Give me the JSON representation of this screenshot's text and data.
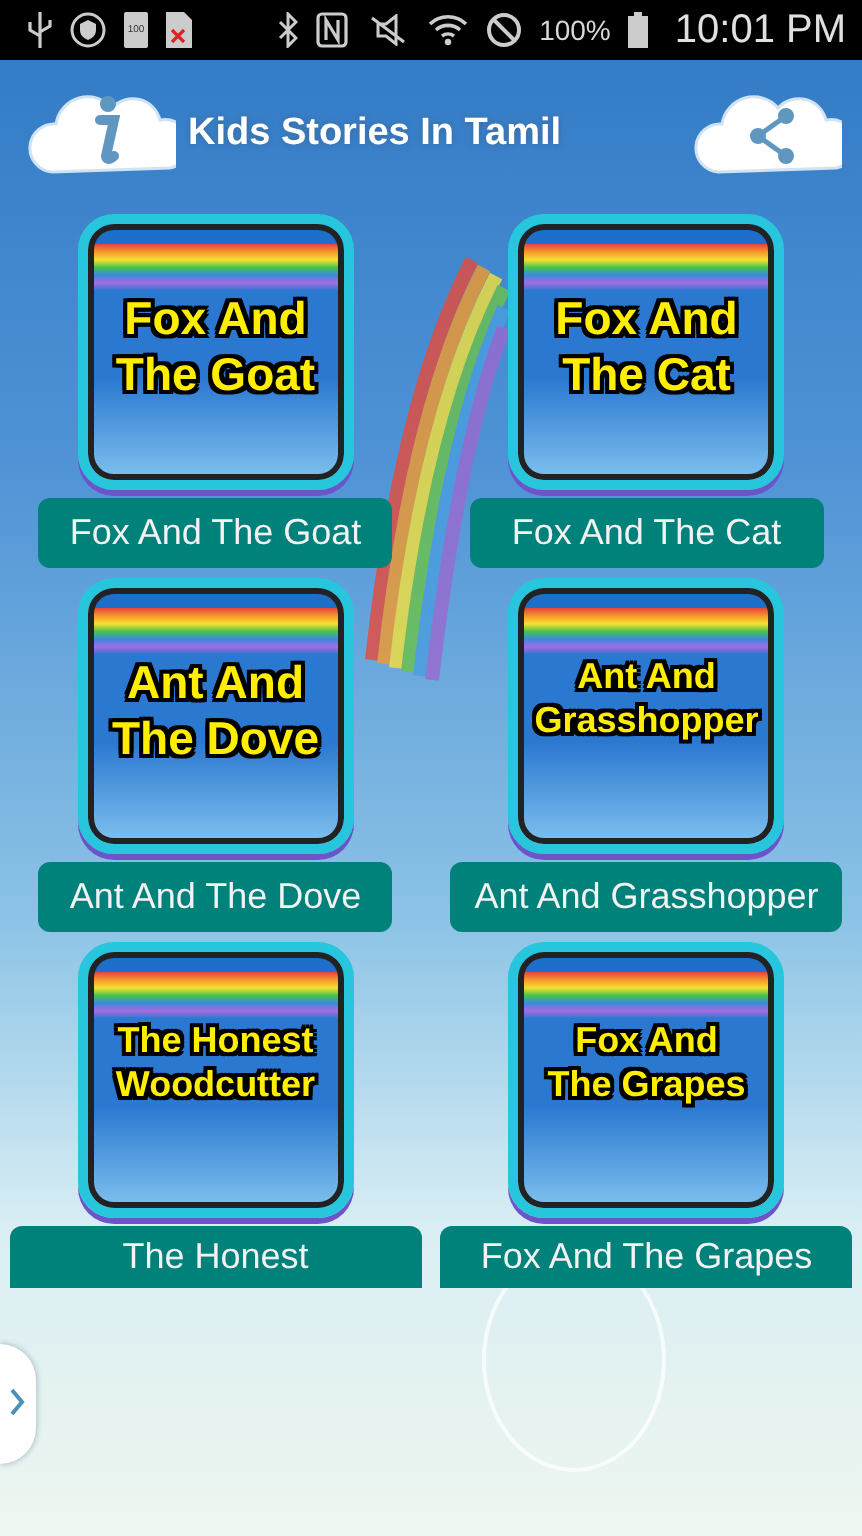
{
  "status_bar": {
    "battery_card": "100",
    "battery_percent": "100%",
    "time": "10:01 PM"
  },
  "header": {
    "title": "Kids Stories In Tamil"
  },
  "stories": [
    {
      "cover_lines": [
        "Fox And",
        "The Goat"
      ],
      "label": "Fox And The Goat"
    },
    {
      "cover_lines": [
        "Fox And",
        "The Cat"
      ],
      "label": "Fox And The Cat"
    },
    {
      "cover_lines": [
        "Ant And",
        "The Dove"
      ],
      "label": "Ant And The Dove"
    },
    {
      "cover_lines": [
        "Ant And",
        "Grasshopper"
      ],
      "label": "Ant And Grasshopper"
    },
    {
      "cover_lines": [
        "The Honest",
        "Woodcutter"
      ],
      "label": "The Honest"
    },
    {
      "cover_lines": [
        "Fox And",
        "The Grapes"
      ],
      "label": "Fox And The Grapes"
    }
  ]
}
